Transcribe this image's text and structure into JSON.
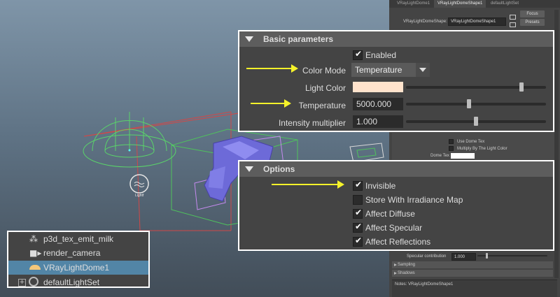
{
  "attribute_editor": {
    "tabs": [
      "VRayLightDome1",
      "VRayLightDomeShape1",
      "defaultLightSet"
    ],
    "node_label": "VRayLightDomeShape:",
    "node_value": "VRayLightDomeShape1",
    "focus_label": "Focus",
    "presets_label": "Presets",
    "use_dome_tex": "Use Dome Tex",
    "multiply_by_light_color": "Multiply By The Light Color",
    "dome_tex": "Dome Tex",
    "specular_contribution_label": "Specular contribution",
    "specular_contribution_value": "1.000",
    "sampling": "Sampling",
    "shadows": "Shadows",
    "notes": "Notes: VRayLightDomeShape1"
  },
  "basic_parameters": {
    "title": "Basic parameters",
    "enabled_label": "Enabled",
    "enabled_checked": true,
    "color_mode_label": "Color Mode",
    "color_mode_value": "Temperature",
    "light_color_label": "Light Color",
    "light_color": "#ffe3cc",
    "temperature_label": "Temperature",
    "temperature_value": "5000.000",
    "temperature_slider": 0.45,
    "intensity_label": "Intensity multiplier",
    "intensity_value": "1.000",
    "intensity_slider": 0.5
  },
  "options": {
    "title": "Options",
    "items": [
      {
        "label": "Invisible",
        "checked": true
      },
      {
        "label": "Store With Irradiance Map",
        "checked": false
      },
      {
        "label": "Affect Diffuse",
        "checked": true
      },
      {
        "label": "Affect Specular",
        "checked": true
      },
      {
        "label": "Affect Reflections",
        "checked": true
      }
    ]
  },
  "outliner": {
    "items": [
      {
        "label": "p3d_tex_emit_milk",
        "selected": false
      },
      {
        "label": "render_camera",
        "selected": false
      },
      {
        "label": "VRayLightDome1",
        "selected": true
      },
      {
        "label": "defaultLightSet",
        "selected": false
      }
    ]
  },
  "viewport": {
    "light_label": "Lightf"
  },
  "colors": {
    "accent_selected": "#5285a6",
    "arrow_yellow": "#f5f22a",
    "panel_bg": "#444444"
  }
}
